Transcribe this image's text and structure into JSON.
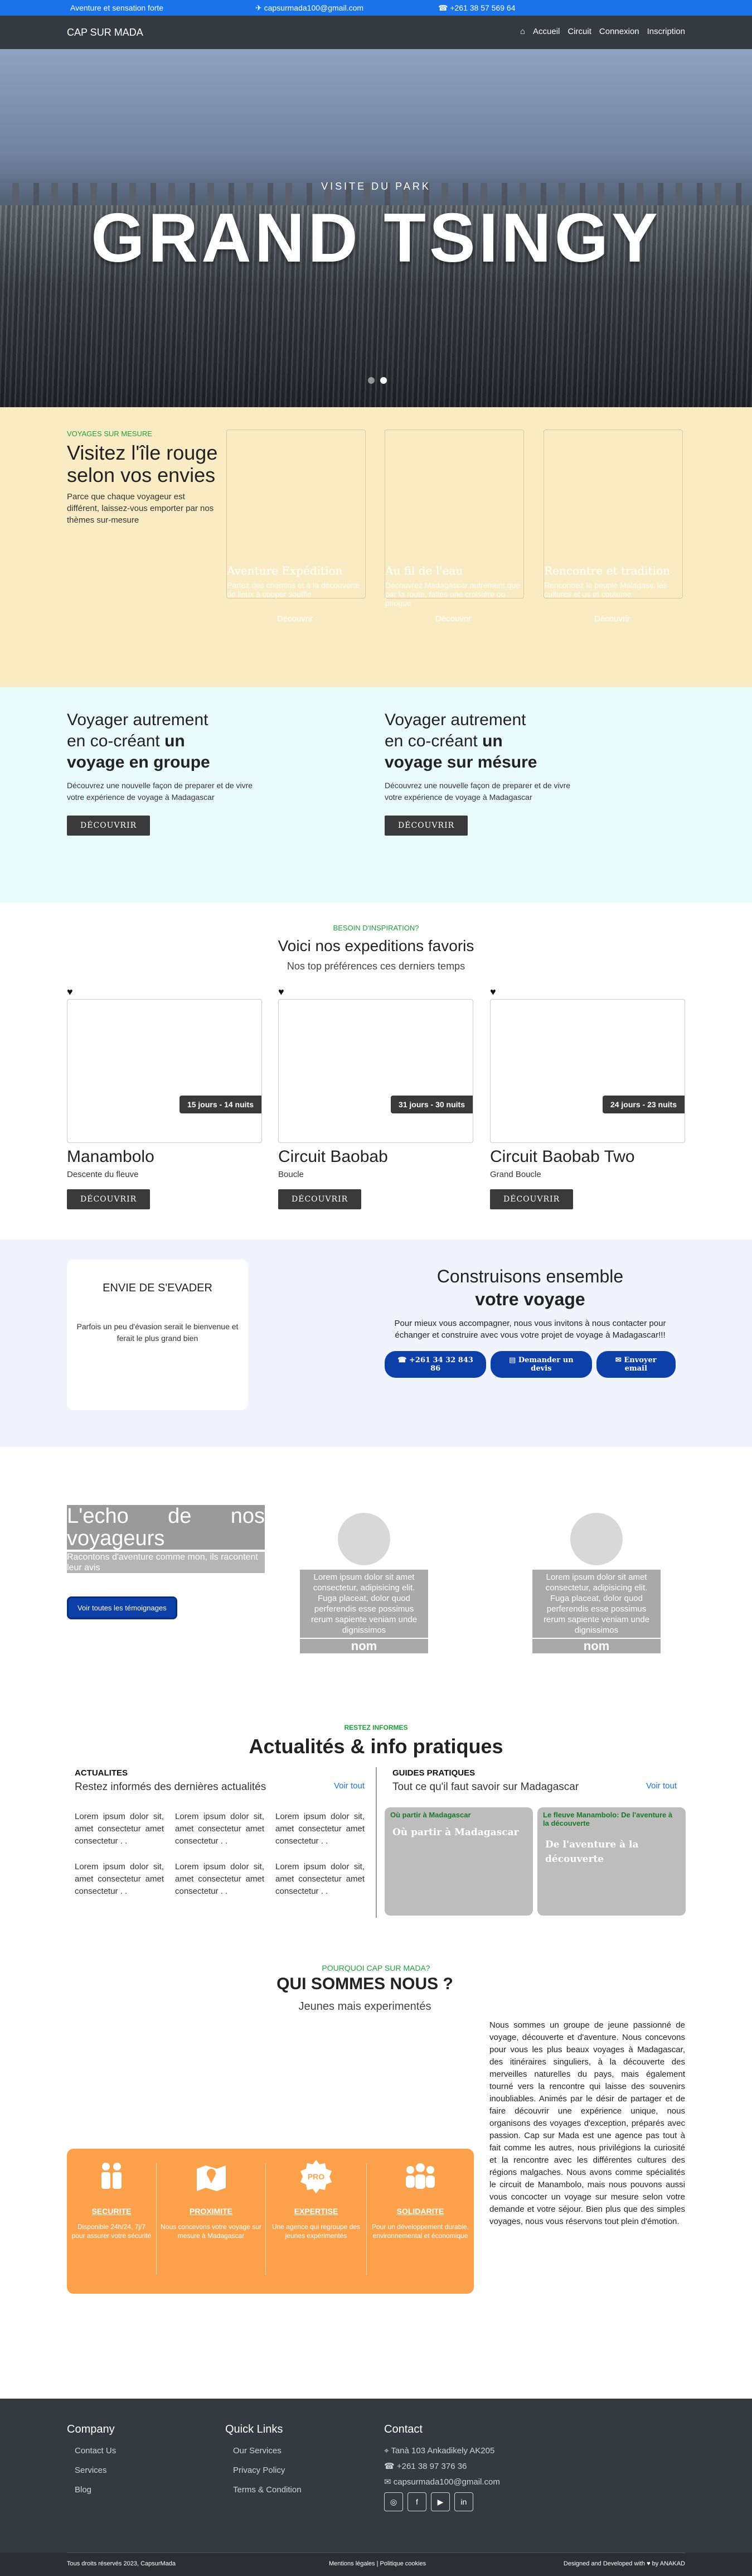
{
  "topbar": {
    "tagline": "Aventure et sensation forte",
    "email": "capsurmada100@gmail.com",
    "phone": "+261 38 57 569 64"
  },
  "nav": {
    "brand": "CAP SUR MADA",
    "links": [
      "Accueil",
      "Circuit",
      "Connexion",
      "Inscription"
    ]
  },
  "hero": {
    "subtitle": "VISITE DU PARK",
    "title": "GRAND TSINGY"
  },
  "mesure": {
    "eyebrow": "VOYAGES SUR MESURE",
    "title": "Visitez l'île rouge selon vos envies",
    "text": "Parce que chaque voyageur est différent, laissez-vous emporter par nos thèmes sur-mesure",
    "tiles": [
      {
        "title": "Aventure Expédition",
        "desc": "Partez des chemins et à la découverte de lieux à couper souffle",
        "button": "Découvrir"
      },
      {
        "title": "Au fil de l'eau",
        "desc": "Découvrez Madagascar autrement que par la route, faites une croisière ou pirogue",
        "button": "Découvrir"
      },
      {
        "title": "Rencontre et tradition",
        "desc": "Rencontrez le peuple Malagasy, les cultures et us et coutume",
        "button": "Découvrir"
      }
    ]
  },
  "autrement": [
    {
      "line1": "Voyager autrement",
      "line2": "en co-créant",
      "bold2": "un",
      "bold3": "voyage en groupe",
      "text": "Découvrez une nouvelle façon de preparer et de vivre votre expérience de voyage à Madagascar",
      "button": "DÉCOUVRIR"
    },
    {
      "line1": "Voyager autrement",
      "line2": "en co-créant",
      "bold2": "un",
      "bold3": "voyage sur mésure",
      "text": "Découvrez une nouvelle façon de preparer et de vivre votre expérience de voyage à Madagascar",
      "button": "DÉCOUVRIR"
    }
  ],
  "expeditions": {
    "eyebrow": "BESOIN D'INSPIRATION?",
    "title": "Voici nos expeditions favoris",
    "subtitle": "Nos top préférences ces derniers temps",
    "cards": [
      {
        "badge": "15 jours - 14 nuits",
        "name": "Manambolo",
        "desc": "Descente du fleuve",
        "button": "DÉCOUVRIR"
      },
      {
        "badge": "31 jours - 30 nuits",
        "name": "Circuit Baobab",
        "desc": "Boucle",
        "button": "DÉCOUVRIR"
      },
      {
        "badge": "24 jours - 23 nuits",
        "name": "Circuit Baobab Two",
        "desc": "Grand Boucle",
        "button": "DÉCOUVRIR"
      }
    ]
  },
  "build": {
    "envie_title": "ENVIE DE S'EVADER",
    "envie_text": "Parfois un peu d'évasion serait le bienvenue et ferait le plus grand bien",
    "title1": "Construisons ensemble",
    "title2": "votre voyage",
    "text": "Pour mieux vous accompagner, nous vous invitons à nous contacter pour échanger et construire avec vous votre projet de voyage à Madagascar!!!",
    "buttons": [
      "+261 34 32 843 86",
      "Demander un devis",
      "Envoyer email"
    ]
  },
  "echo": {
    "title": "L'echo de nos voyageurs",
    "subtitle": "Racontons d'aventure comme mon, ils racontent leur avis",
    "button": "Voir toutes les témoignages",
    "testimonials": [
      {
        "text": "Lorem ipsum dolor sit amet consectetur, adipisicing elit. Fuga placeat, dolor quod perferendis esse possimus rerum sapiente veniam unde dignissimos",
        "name": "nom"
      },
      {
        "text": "Lorem ipsum dolor sit amet consectetur, adipisicing elit. Fuga placeat, dolor quod perferendis esse possimus rerum sapiente veniam unde dignissimos",
        "name": "nom"
      }
    ]
  },
  "news": {
    "eyebrow": "RESTEZ INFORMES",
    "title": "Actualités & info pratiques",
    "left_label": "ACTUALITES",
    "left_sub": "Restez informés des dernières actualités",
    "left_link": "Voir tout",
    "items": [
      "Lorem ipsum dolor sit, amet consectetur amet consectetur . .",
      "Lorem ipsum dolor sit, amet consectetur amet consectetur . .",
      "Lorem ipsum dolor sit, amet consectetur amet consectetur . .",
      "Lorem ipsum dolor sit, amet consectetur amet consectetur . .",
      "Lorem ipsum dolor sit, amet consectetur amet consectetur . .",
      "Lorem ipsum dolor sit, amet consectetur amet consectetur . ."
    ],
    "right_label": "GUIDES PRATIQUES",
    "right_sub": "Tout ce qu'il faut savoir sur Madagascar",
    "right_link": "Voir tout",
    "guides": [
      {
        "label": "Où partir à Madagascar",
        "title": "Où partir à Madagascar"
      },
      {
        "label": "Le fleuve Manambolo: De l'aventure à la découverte",
        "title": "De l'aventure à la découverte"
      }
    ]
  },
  "qui": {
    "eyebrow": "POURQUOI CAP SUR MADA?",
    "title": "QUI SOMMES NOUS ?",
    "subtitle": "Jeunes mais experimentés",
    "text": "Nous sommes un groupe de jeune passionné de voyage, découverte et d'aventure. Nous concevons pour vous les plus beaux voyages à Madagascar, des itinéraires singuliers, à la découverte des merveilles naturelles du pays, mais également tourné vers la rencontre qui laisse des souvenirs inoubliables. Animés par le désir de partager et de faire découvrir une expérience unique, nous organisons des voyages d'exception, préparés avec passion. Cap sur Mada est une agence pas tout à fait comme les autres, nous privilégions la curiosité et la rencontre avec les différentes cultures des régions malgaches. Nous avons comme spécialités le circuit de Manambolo, mais nous pouvons aussi vous concocter un voyage sur mesure selon votre demande et votre séjour. Bien plus que des simples voyages, nous vous réservons tout plein d'émotion.",
    "values": [
      {
        "icon": "family-icon",
        "title": "SECURITE",
        "desc": "Disponible 24h/24, 7j/7 pour assurer votre sécurité"
      },
      {
        "icon": "map-icon",
        "title": "PROXIMITE",
        "desc": "Nous concevons votre voyage sur mesure à Madagascar"
      },
      {
        "icon": "pro-badge-icon",
        "title": "EXPERTISE",
        "desc": "Une agence qui regroupe des jeunes expérimentés"
      },
      {
        "icon": "group-icon",
        "title": "SOLIDARITE",
        "desc": "Pour un développement durable, environnemental et économique"
      }
    ]
  },
  "footer": {
    "company_title": "Company",
    "company_items": [
      "Contact Us",
      "Services",
      "Blog"
    ],
    "quick_title": "Quick Links",
    "quick_items": [
      "Our Services",
      "Privacy Policy",
      "Terms & Condition"
    ],
    "contact_title": "Contact",
    "contact_items": [
      "Tanà 103 Ankadikely AK205",
      "+261 38 97 376 36",
      "capsurmada100@gmail.com"
    ],
    "social": [
      "ig",
      "f",
      "yt",
      "in"
    ],
    "copyright": "Tous droits réservés 2023, CapsurMada",
    "legal": "Mentions légales | Politique cookies",
    "credits": "Designed and Developed with ♥ by ANAKAD"
  },
  "colors": {
    "topbar": "#1a73e8",
    "nav": "#343a40",
    "accent_green": "#1e9e3a",
    "button_blue": "#0d3fa8",
    "orange": "#fca14b"
  }
}
